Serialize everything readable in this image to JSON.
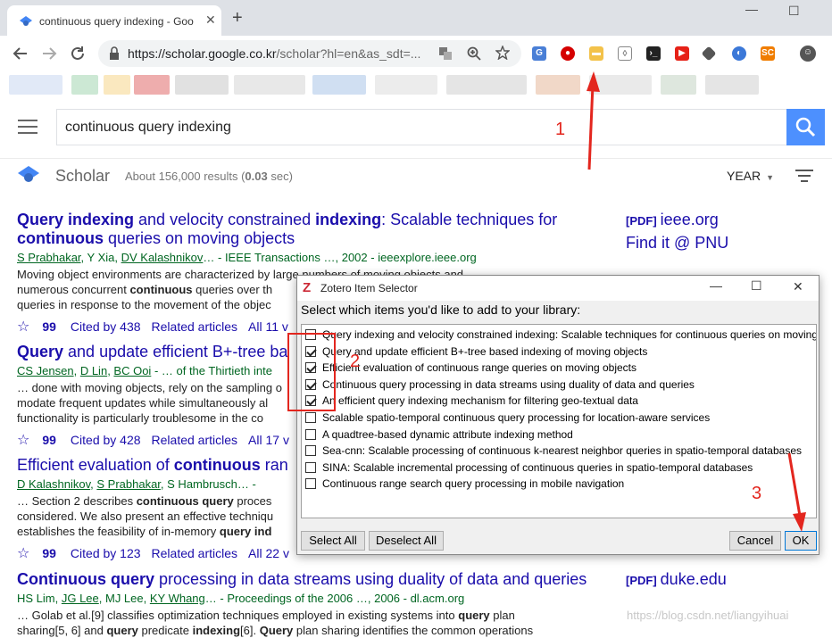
{
  "browser": {
    "tab_title": "continuous query indexing - Goo",
    "tab_close": "✕",
    "new_tab": "+",
    "url_host": "https://scholar.google.co.kr",
    "url_path": "/scholar?hl=en&as_sdt=...",
    "window_min": "—",
    "window_max": "☐"
  },
  "header": {
    "query": "continuous query indexing",
    "scholar_word": "Scholar",
    "results_prefix": "About 156,000 results (",
    "results_time": "0.03",
    "results_suffix": " sec)",
    "year_label": "YEAR",
    "year_caret": "▼"
  },
  "results": [
    {
      "title_parts": [
        "Query indexing",
        " and velocity constrained ",
        "indexing",
        ": Scalable techniques for ",
        "continuous",
        " queries on moving objects"
      ],
      "authors": [
        "S Prabhakar",
        ", Y Xia, ",
        "DV Kalashnikov",
        "… - IEEE Transactions …, 2002 - ieeexplore.ieee.org"
      ],
      "snippet_lines": [
        "Moving object environments are characterized by large numbers of moving objects and",
        "numerous concurrent ",
        "continuous",
        " queries over th",
        "queries in response to the movement of the objec"
      ],
      "cited": "Cited by 438",
      "related": "Related articles",
      "all": "All 11 v",
      "side_pdf": "[PDF]",
      "side_host": "ieee.org",
      "side_extra": "Find it @ PNU"
    },
    {
      "title_parts": [
        "Query",
        " and update efficient B+-tree ba"
      ],
      "authors": [
        "CS Jensen",
        ", ",
        "D Lin",
        ", ",
        "BC Ooi",
        " - … of the Thirtieth inte"
      ],
      "snippet_lines": [
        "… done with moving objects, rely on the sampling o",
        "modate frequent updates while simultaneously al",
        "functionality is particularly troublesome in the co"
      ],
      "cited": "Cited by 428",
      "related": "Related articles",
      "all": "All 17 v"
    },
    {
      "title_parts": [
        "Efficient evaluation of ",
        "continuous",
        " ran"
      ],
      "authors": [
        "D Kalashnikov",
        ", ",
        "S Prabhakar",
        ", S Hambrusch… - "
      ],
      "snippet_lines": [
        "… Section 2 describes ",
        "continuous query",
        " proces",
        "considered. We also present an effective techniqu",
        "establishes the feasibility of in-memory ",
        "query ind"
      ],
      "cited": "Cited by 123",
      "related": "Related articles",
      "all": "All 22 v"
    },
    {
      "title_parts": [
        "Continuous query",
        " processing in data streams using duality of data and queries"
      ],
      "authors": [
        "HS Lim, ",
        "JG Lee",
        ", MJ Lee, ",
        "KY Whang",
        "… - Proceedings of the 2006 …, 2006 - dl.acm.org"
      ],
      "snippet_lines": [
        "… Golab et al.[9] classifies optimization techniques employed in existing systems into ",
        "query",
        " plan",
        "sharing[5, 6] and ",
        "query",
        " predicate ",
        "indexing",
        "[6]. ",
        "Query",
        " plan sharing identifies the common operations"
      ],
      "side_pdf": "[PDF]",
      "side_host": "duke.edu"
    }
  ],
  "dialog": {
    "title": "Zotero Item Selector",
    "prompt": "Select which items you'd like to add to your library:",
    "items": [
      {
        "label": "Query indexing and velocity constrained indexing: Scalable techniques for continuous queries on moving",
        "checked": false
      },
      {
        "label": "Query and update efficient B+-tree based indexing of moving objects",
        "checked": true
      },
      {
        "label": "Efficient evaluation of continuous range queries on moving objects",
        "checked": true
      },
      {
        "label": "Continuous query processing in data streams using duality of data and queries",
        "checked": true
      },
      {
        "label": "An efficient query indexing mechanism for filtering geo-textual data",
        "checked": true
      },
      {
        "label": "Scalable spatio-temporal continuous query processing for location-aware services",
        "checked": false
      },
      {
        "label": "A quadtree-based dynamic attribute indexing method",
        "checked": false
      },
      {
        "label": "Sea-cnn: Scalable processing of continuous k-nearest neighbor queries in spatio-temporal databases",
        "checked": false
      },
      {
        "label": "SINA: Scalable incremental processing of continuous queries in spatio-temporal databases",
        "checked": false
      },
      {
        "label": "Continuous range search query processing in mobile navigation",
        "checked": false
      }
    ],
    "select_all": "Select All",
    "deselect_all": "Deselect All",
    "cancel": "Cancel",
    "ok": "OK"
  },
  "annotations": {
    "one": "1",
    "two": "2",
    "three": "3"
  },
  "watermark": "https://blog.csdn.net/liangyihuai",
  "colors": {
    "link": "#1a0dab",
    "author": "#006621",
    "search_button": "#4d90fe",
    "annotation": "#e3261e"
  }
}
